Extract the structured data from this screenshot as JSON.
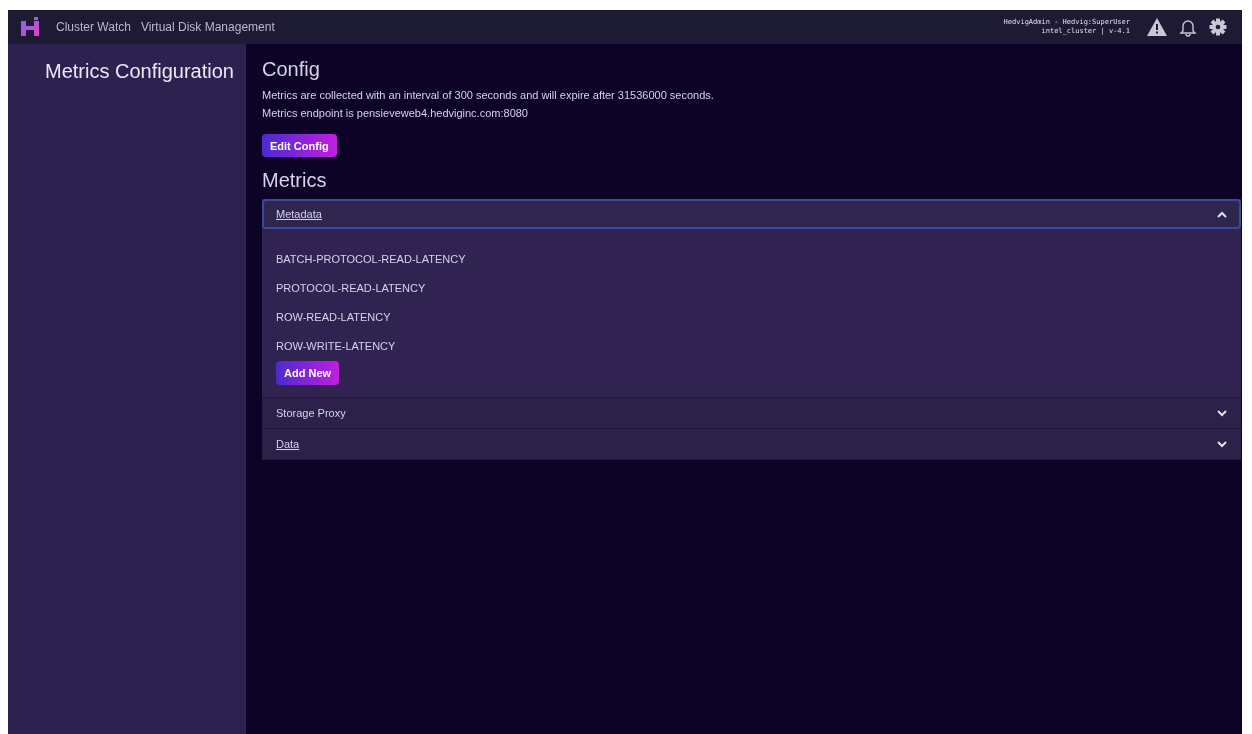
{
  "topbar": {
    "nav": [
      "Cluster Watch",
      "Virtual Disk Management"
    ],
    "user": "HedvigAdmin - Hedvig:SuperUser",
    "cluster": "intel_cluster | v-4.1"
  },
  "sidebar": {
    "title": "Metrics Configuration"
  },
  "config": {
    "heading": "Config",
    "lines": [
      "Metrics are collected with an interval of 300 seconds and will expire after 31536000 seconds.",
      "Metrics endpoint is pensieveweb4.hedviginc.com:8080"
    ],
    "button": "Edit Config"
  },
  "metrics": {
    "heading": "Metrics",
    "sections": [
      {
        "title": "Metadata",
        "expanded": true,
        "focused": true,
        "underlined": true,
        "items": [
          "BATCH-PROTOCOL-READ-LATENCY",
          "PROTOCOL-READ-LATENCY",
          "ROW-READ-LATENCY",
          "ROW-WRITE-LATENCY"
        ],
        "button": "Add New"
      },
      {
        "title": "Storage Proxy",
        "expanded": false,
        "focused": false,
        "underlined": false
      },
      {
        "title": "Data",
        "expanded": false,
        "focused": false,
        "underlined": true
      }
    ]
  }
}
